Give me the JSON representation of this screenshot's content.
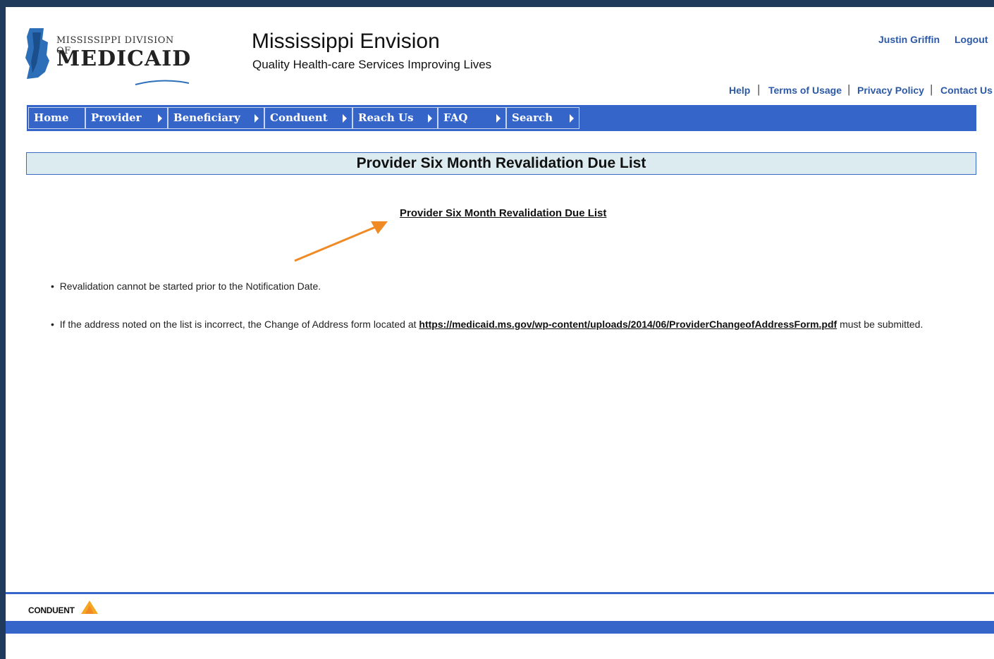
{
  "header": {
    "logo_top": "MISSISSIPPI DIVISION OF",
    "logo_main": "MEDICAID",
    "title": "Mississippi Envision",
    "tagline": "Quality Health-care Services Improving Lives",
    "user_name": "Justin Griffin",
    "logout": "Logout",
    "links": [
      "Help",
      "Terms of Usage",
      "Privacy Policy",
      "Contact Us"
    ]
  },
  "nav": {
    "items": [
      "Home",
      "Provider",
      "Beneficiary",
      "Conduent",
      "Reach Us",
      "FAQ",
      "Search"
    ]
  },
  "main": {
    "page_title": "Provider Six Month Revalidation Due List",
    "download_link": "Provider Six Month Revalidation Due List",
    "bullet1": "Revalidation cannot be started prior to the Notification Date.",
    "bullet2_pre": "If the address noted on the list is incorrect, the Change of Address form located at ",
    "bullet2_link": "https://medicaid.ms.gov/wp-content/uploads/2014/06/ProviderChangeofAddressForm.pdf",
    "bullet2_post": " must be submitted."
  },
  "footer": {
    "brand": "CONDUENT"
  },
  "colors": {
    "nav_blue": "#3565c8",
    "link_blue": "#2c5aa8",
    "frame_bg": "#1f3a5b",
    "annotation_arrow": "#f08a24"
  }
}
